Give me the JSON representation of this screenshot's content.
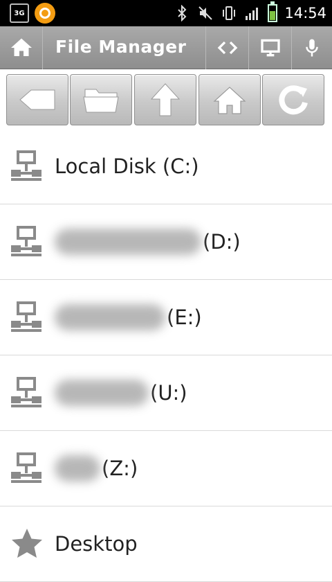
{
  "status_bar": {
    "network_badge": "3G",
    "time": "14:54",
    "icons": [
      "bluetooth-icon",
      "mute-icon",
      "vibrate-icon",
      "signal-icon",
      "battery-icon"
    ],
    "battery_fraction": 0.6
  },
  "title_bar": {
    "title": "File Manager",
    "icons": [
      "home-icon",
      "code-icon",
      "monitor-icon",
      "microphone-icon"
    ]
  },
  "toolbar": {
    "buttons": [
      "back-icon",
      "folder-icon",
      "up-arrow-icon",
      "home-icon",
      "refresh-icon"
    ]
  },
  "list": {
    "items": [
      {
        "label": "Local Disk (C:)",
        "icon": "network-drive-icon"
      },
      {
        "label": "(D:)",
        "icon": "network-drive-icon"
      },
      {
        "label": "(E:)",
        "icon": "network-drive-icon"
      },
      {
        "label": "(U:)",
        "icon": "network-drive-icon"
      },
      {
        "label": "(Z:)",
        "icon": "network-drive-icon"
      },
      {
        "label": "Desktop",
        "icon": "star-icon"
      }
    ]
  },
  "colors": {
    "title_bar": "#9a9a9a",
    "status_bar": "#000000",
    "icon_gray": "#8a8a8a",
    "accent_orange": "#f39c12"
  }
}
